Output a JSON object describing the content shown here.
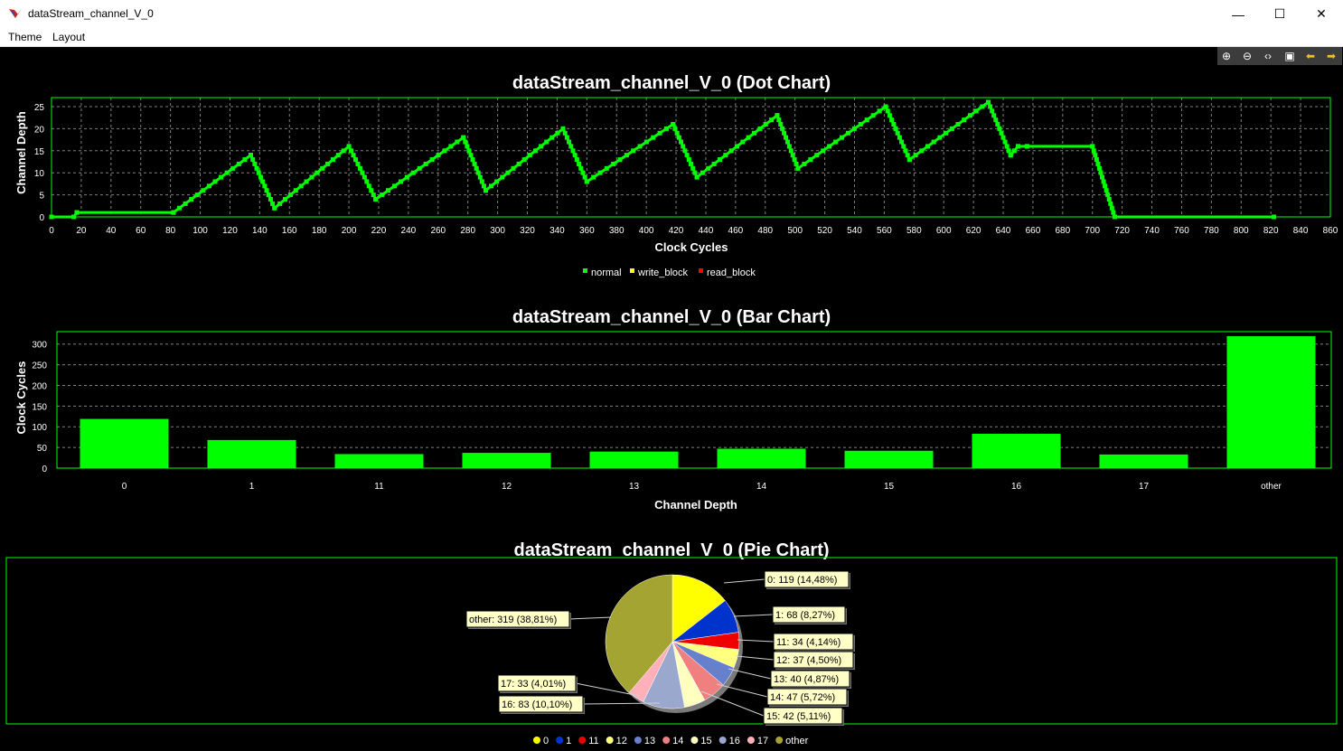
{
  "window": {
    "title": "dataStream_channel_V_0",
    "minimize": "—",
    "maximize": "☐",
    "close": "✕"
  },
  "menu": {
    "items": [
      "Theme",
      "Layout"
    ]
  },
  "toolbar": {
    "icons": [
      "zoom-in-icon",
      "zoom-out-icon",
      "fit-icon",
      "reset-icon",
      "back-arrow-icon",
      "forward-arrow-icon"
    ],
    "glyphs": [
      "⊕",
      "⊖",
      "‹›",
      "▣",
      "⬅",
      "➡"
    ]
  },
  "colors": {
    "green": "#00ff00",
    "yellow": "#ffff00",
    "red": "#ff0000",
    "grid": "#808080",
    "pie_other": "#a4a432"
  },
  "chart_data": [
    {
      "type": "line",
      "title": "dataStream_channel_V_0 (Dot Chart)",
      "xlabel": "Clock Cycles",
      "ylabel": "Channel Depth",
      "xlim": [
        0,
        860
      ],
      "ylim": [
        0,
        25
      ],
      "xticks": [
        0,
        20,
        40,
        60,
        80,
        100,
        120,
        140,
        160,
        180,
        200,
        220,
        240,
        260,
        280,
        300,
        320,
        340,
        360,
        380,
        400,
        420,
        440,
        460,
        480,
        500,
        520,
        540,
        560,
        580,
        600,
        620,
        640,
        660,
        680,
        700,
        720,
        740,
        760,
        780,
        800,
        820,
        840,
        860
      ],
      "yticks": [
        0,
        5,
        10,
        15,
        20,
        25
      ],
      "legend": [
        "normal",
        "write_block",
        "read_block"
      ],
      "legend_colors": [
        "#00ff00",
        "#ffff00",
        "#ff0000"
      ],
      "series": [
        {
          "name": "normal",
          "x": [
            0,
            15,
            17,
            82,
            134,
            150,
            200,
            218,
            277,
            292,
            344,
            360,
            418,
            434,
            488,
            502,
            561,
            577,
            630,
            645,
            650,
            656,
            700,
            715,
            822
          ],
          "y": [
            0,
            0,
            1,
            1,
            14,
            2,
            16,
            4,
            18,
            6,
            20,
            8,
            21,
            9,
            23,
            11,
            25,
            13,
            26,
            14,
            16,
            16,
            16,
            0,
            0
          ]
        }
      ]
    },
    {
      "type": "bar",
      "title": "dataStream_channel_V_0 (Bar Chart)",
      "xlabel": "Channel Depth",
      "ylabel": "Clock Cycles",
      "ylim": [
        0,
        330
      ],
      "yticks": [
        0,
        50,
        100,
        150,
        200,
        250,
        300
      ],
      "categories": [
        "0",
        "1",
        "11",
        "12",
        "13",
        "14",
        "15",
        "16",
        "17",
        "other"
      ],
      "values": [
        119,
        68,
        34,
        37,
        40,
        47,
        42,
        83,
        33,
        319
      ]
    },
    {
      "type": "pie",
      "title": "dataStream_channel_V_0 (Pie Chart)",
      "slices": [
        {
          "label": "0",
          "value": 119,
          "text": "0: 119 (14,48%)",
          "color": "#ffff00"
        },
        {
          "label": "1",
          "value": 68,
          "text": "1: 68 (8,27%)",
          "color": "#0033cc"
        },
        {
          "label": "11",
          "value": 34,
          "text": "11: 34 (4,14%)",
          "color": "#ee0000"
        },
        {
          "label": "12",
          "value": 37,
          "text": "12: 37 (4,50%)",
          "color": "#ffff80"
        },
        {
          "label": "13",
          "value": 40,
          "text": "13: 40 (4,87%)",
          "color": "#6680cc"
        },
        {
          "label": "14",
          "value": 47,
          "text": "14: 47 (5,72%)",
          "color": "#f08080"
        },
        {
          "label": "15",
          "value": 42,
          "text": "15: 42 (5,11%)",
          "color": "#ffffc0"
        },
        {
          "label": "16",
          "value": 83,
          "text": "16: 83 (10,10%)",
          "color": "#99a8cc"
        },
        {
          "label": "17",
          "value": 33,
          "text": "17: 33 (4,01%)",
          "color": "#ffb0b8"
        },
        {
          "label": "other",
          "value": 319,
          "text": "other: 319 (38,81%)",
          "color": "#a4a432"
        }
      ]
    }
  ]
}
